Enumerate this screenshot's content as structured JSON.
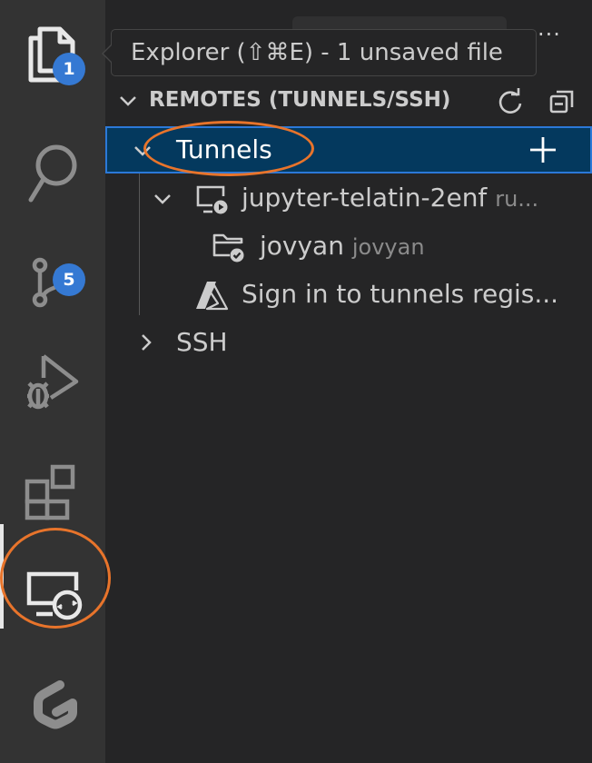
{
  "activity_bar": {
    "explorer_badge": "1",
    "scm_badge": "5"
  },
  "tooltip": {
    "text": "Explorer (⇧⌘E) - 1 unsaved file"
  },
  "sidebar": {
    "more_actions": "···",
    "section_title": "REMOTES (TUNNELS/SSH)",
    "tree": {
      "tunnels_label": "Tunnels",
      "tunnel_name": "jupyter-telatin-2enf",
      "tunnel_desc": "ru...",
      "workspace_name": "jovyan",
      "workspace_desc": "jovyan",
      "sign_in_label": "Sign in to tunnels regis...",
      "ssh_label": "SSH"
    }
  },
  "colors": {
    "activity_bar_bg": "#333333",
    "sidebar_bg": "#252526",
    "selection_bg": "#04395e",
    "selection_border": "#2b79d8",
    "badge_bg": "#3579d3",
    "annotation_orange": "#e8742b"
  },
  "icons": [
    "files-icon",
    "search-icon",
    "source-control-icon",
    "run-debug-icon",
    "extensions-icon",
    "remote-explorer-icon",
    "gitpod-logo-icon",
    "refresh-icon",
    "collapse-all-icon",
    "plus-icon",
    "chevron-down-icon",
    "chevron-right-icon",
    "remote-tunnel-icon",
    "folder-connected-icon",
    "azure-icon"
  ]
}
